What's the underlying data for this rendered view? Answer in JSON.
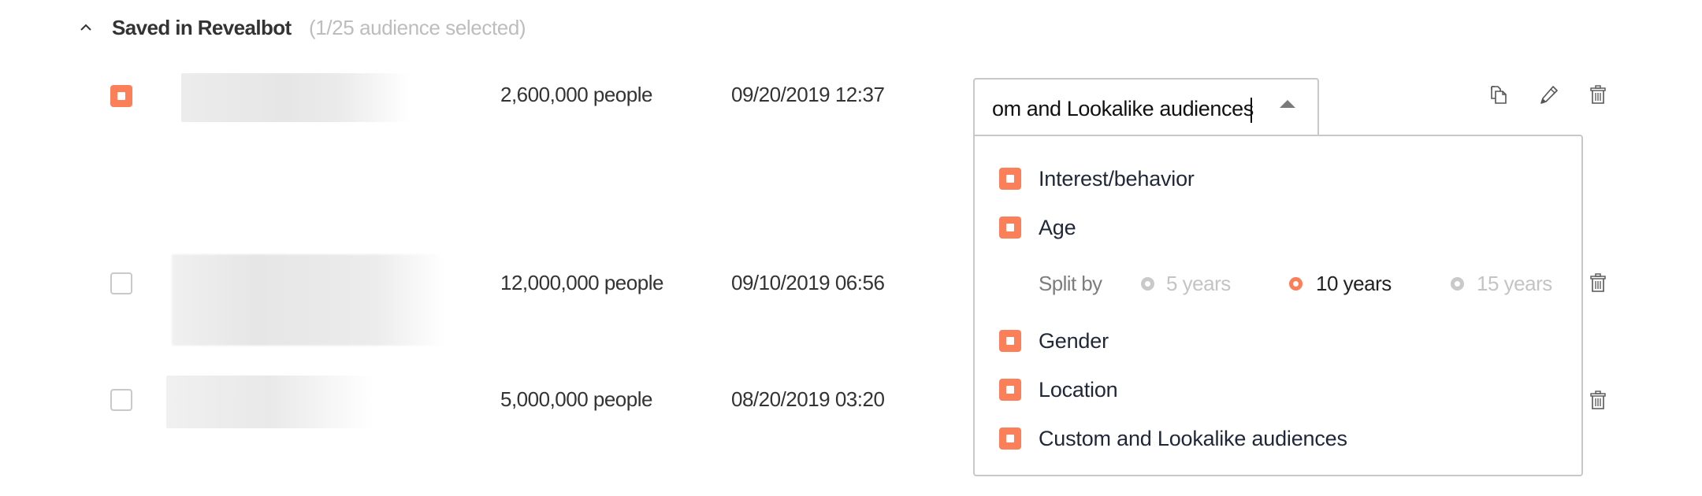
{
  "section": {
    "title": "Saved in Revealbot",
    "subtitle": "(1/25 audience selected)",
    "toggle_icon": "chevron-up-icon"
  },
  "audiences": [
    {
      "selected": true,
      "name": "[blurred]",
      "size": "2,600,000 people",
      "date": "09/20/2019 12:37",
      "actions": [
        "copy-icon",
        "edit-icon",
        "trash-icon"
      ]
    },
    {
      "selected": false,
      "name": "[blurred]",
      "size": "12,000,000 people",
      "date": "09/10/2019 06:56",
      "actions": [
        "trash-icon"
      ]
    },
    {
      "selected": false,
      "name": "[blurred]",
      "size": "5,000,000 people",
      "date": "08/20/2019 03:20",
      "actions": [
        "trash-icon"
      ]
    }
  ],
  "split_select": {
    "value": "om and Lookalike audiences",
    "full_value": "Custom and Lookalike audiences",
    "expanded": true,
    "options": [
      {
        "label": "Interest/behavior",
        "checked": true
      },
      {
        "label": "Age",
        "checked": true
      },
      {
        "label": "Gender",
        "checked": true
      },
      {
        "label": "Location",
        "checked": true
      },
      {
        "label": "Custom and Lookalike audiences",
        "checked": true
      }
    ],
    "age_split": {
      "label": "Split by",
      "options": [
        {
          "label": "5 years",
          "selected": false
        },
        {
          "label": "10 years",
          "selected": true
        },
        {
          "label": "15 years",
          "selected": false
        }
      ]
    }
  },
  "colors": {
    "accent": "#fb7f58",
    "text": "#333333",
    "muted": "#bdbdbd",
    "border": "#c8c8c8",
    "option_text": "#1f2738"
  }
}
